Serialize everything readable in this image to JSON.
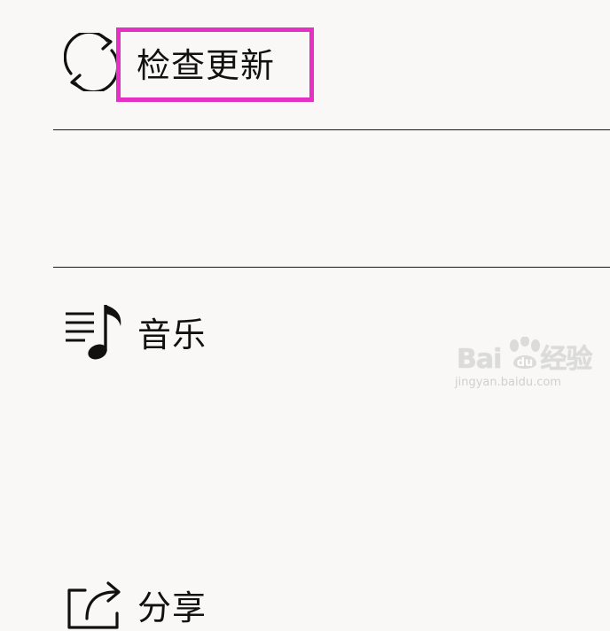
{
  "menu": {
    "items": [
      {
        "label": "检查更新",
        "icon": "refresh-icon"
      },
      {
        "label": "音乐",
        "icon": "music-note-icon"
      },
      {
        "label": "分享",
        "icon": "share-icon"
      }
    ]
  },
  "annotation": {
    "highlight_color": "#e62fc4"
  },
  "watermark": {
    "brand_left": "Bai",
    "brand_right": "经验",
    "url": "jingyan.baidu.com"
  }
}
